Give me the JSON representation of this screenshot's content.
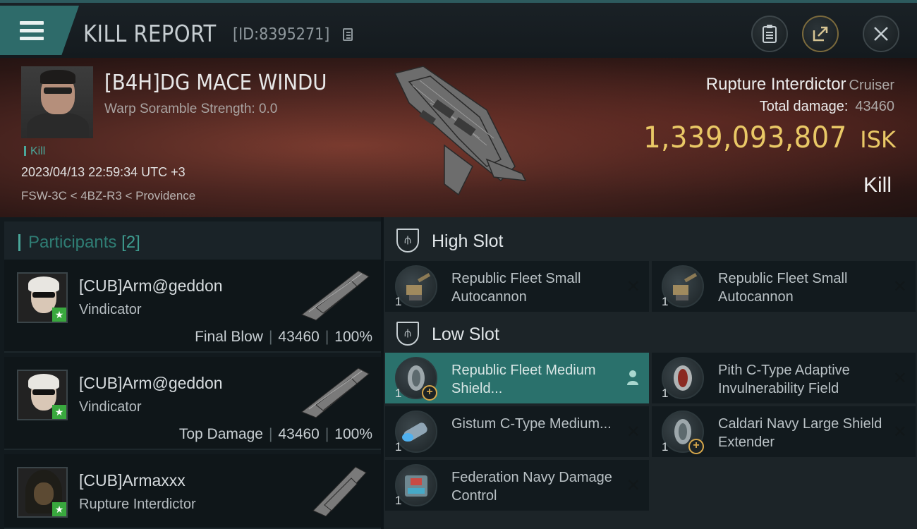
{
  "header": {
    "title": "KILL REPORT",
    "report_id": "[ID:8395271]"
  },
  "victim": {
    "name": "[B4H]DG MACE WINDU",
    "scramble": "Warp Soramble Strength: 0.0",
    "tag": "Kill",
    "datetime": "2023/04/13 22:59:34 UTC +3",
    "location": "FSW-3C < 4BZ-R3 < Providence",
    "ship_name": "Rupture Interdictor",
    "ship_class": "Cruiser",
    "damage_label": "Total damage:",
    "damage_value": "43460",
    "isk_value": "1,339,093,807",
    "isk_unit": "ISK",
    "result": "Kill"
  },
  "participants": {
    "label": "Participants",
    "count": "[2]",
    "items": [
      {
        "name": "[CUB]Arm@geddon",
        "ship": "Vindicator",
        "role": "Final Blow",
        "damage": "43460",
        "percent": "100%"
      },
      {
        "name": "[CUB]Arm@geddon",
        "ship": "Vindicator",
        "role": "Top Damage",
        "damage": "43460",
        "percent": "100%"
      },
      {
        "name": "[CUB]Armaxxx",
        "ship": "Rupture Interdictor",
        "role": "",
        "damage": "",
        "percent": ""
      }
    ]
  },
  "fitting": {
    "high_slot": {
      "title": "High Slot",
      "modules": [
        {
          "qty": "1",
          "name": "Republic Fleet Small Autocannon"
        },
        {
          "qty": "1",
          "name": "Republic Fleet Small Autocannon"
        }
      ]
    },
    "low_slot": {
      "title": "Low Slot",
      "modules": [
        {
          "qty": "1",
          "name": "Republic Fleet Medium Shield..."
        },
        {
          "qty": "1",
          "name": "Pith C-Type Adaptive Invulnerability Field"
        },
        {
          "qty": "1",
          "name": "Gistum C-Type Medium..."
        },
        {
          "qty": "1",
          "name": "Caldari Navy Large Shield Extender"
        },
        {
          "qty": "1",
          "name": "Federation Navy Damage Control"
        }
      ]
    }
  },
  "colors": {
    "accent": "#2e6b6a",
    "isk": "#e9c866",
    "highlight": "#2a716c"
  },
  "icons": {
    "menu": "hamburger-icon",
    "copy": "copy-icon",
    "clipboard": "clipboard-icon",
    "share": "share-icon",
    "close": "close-icon",
    "slot": "shield-slot-icon"
  }
}
